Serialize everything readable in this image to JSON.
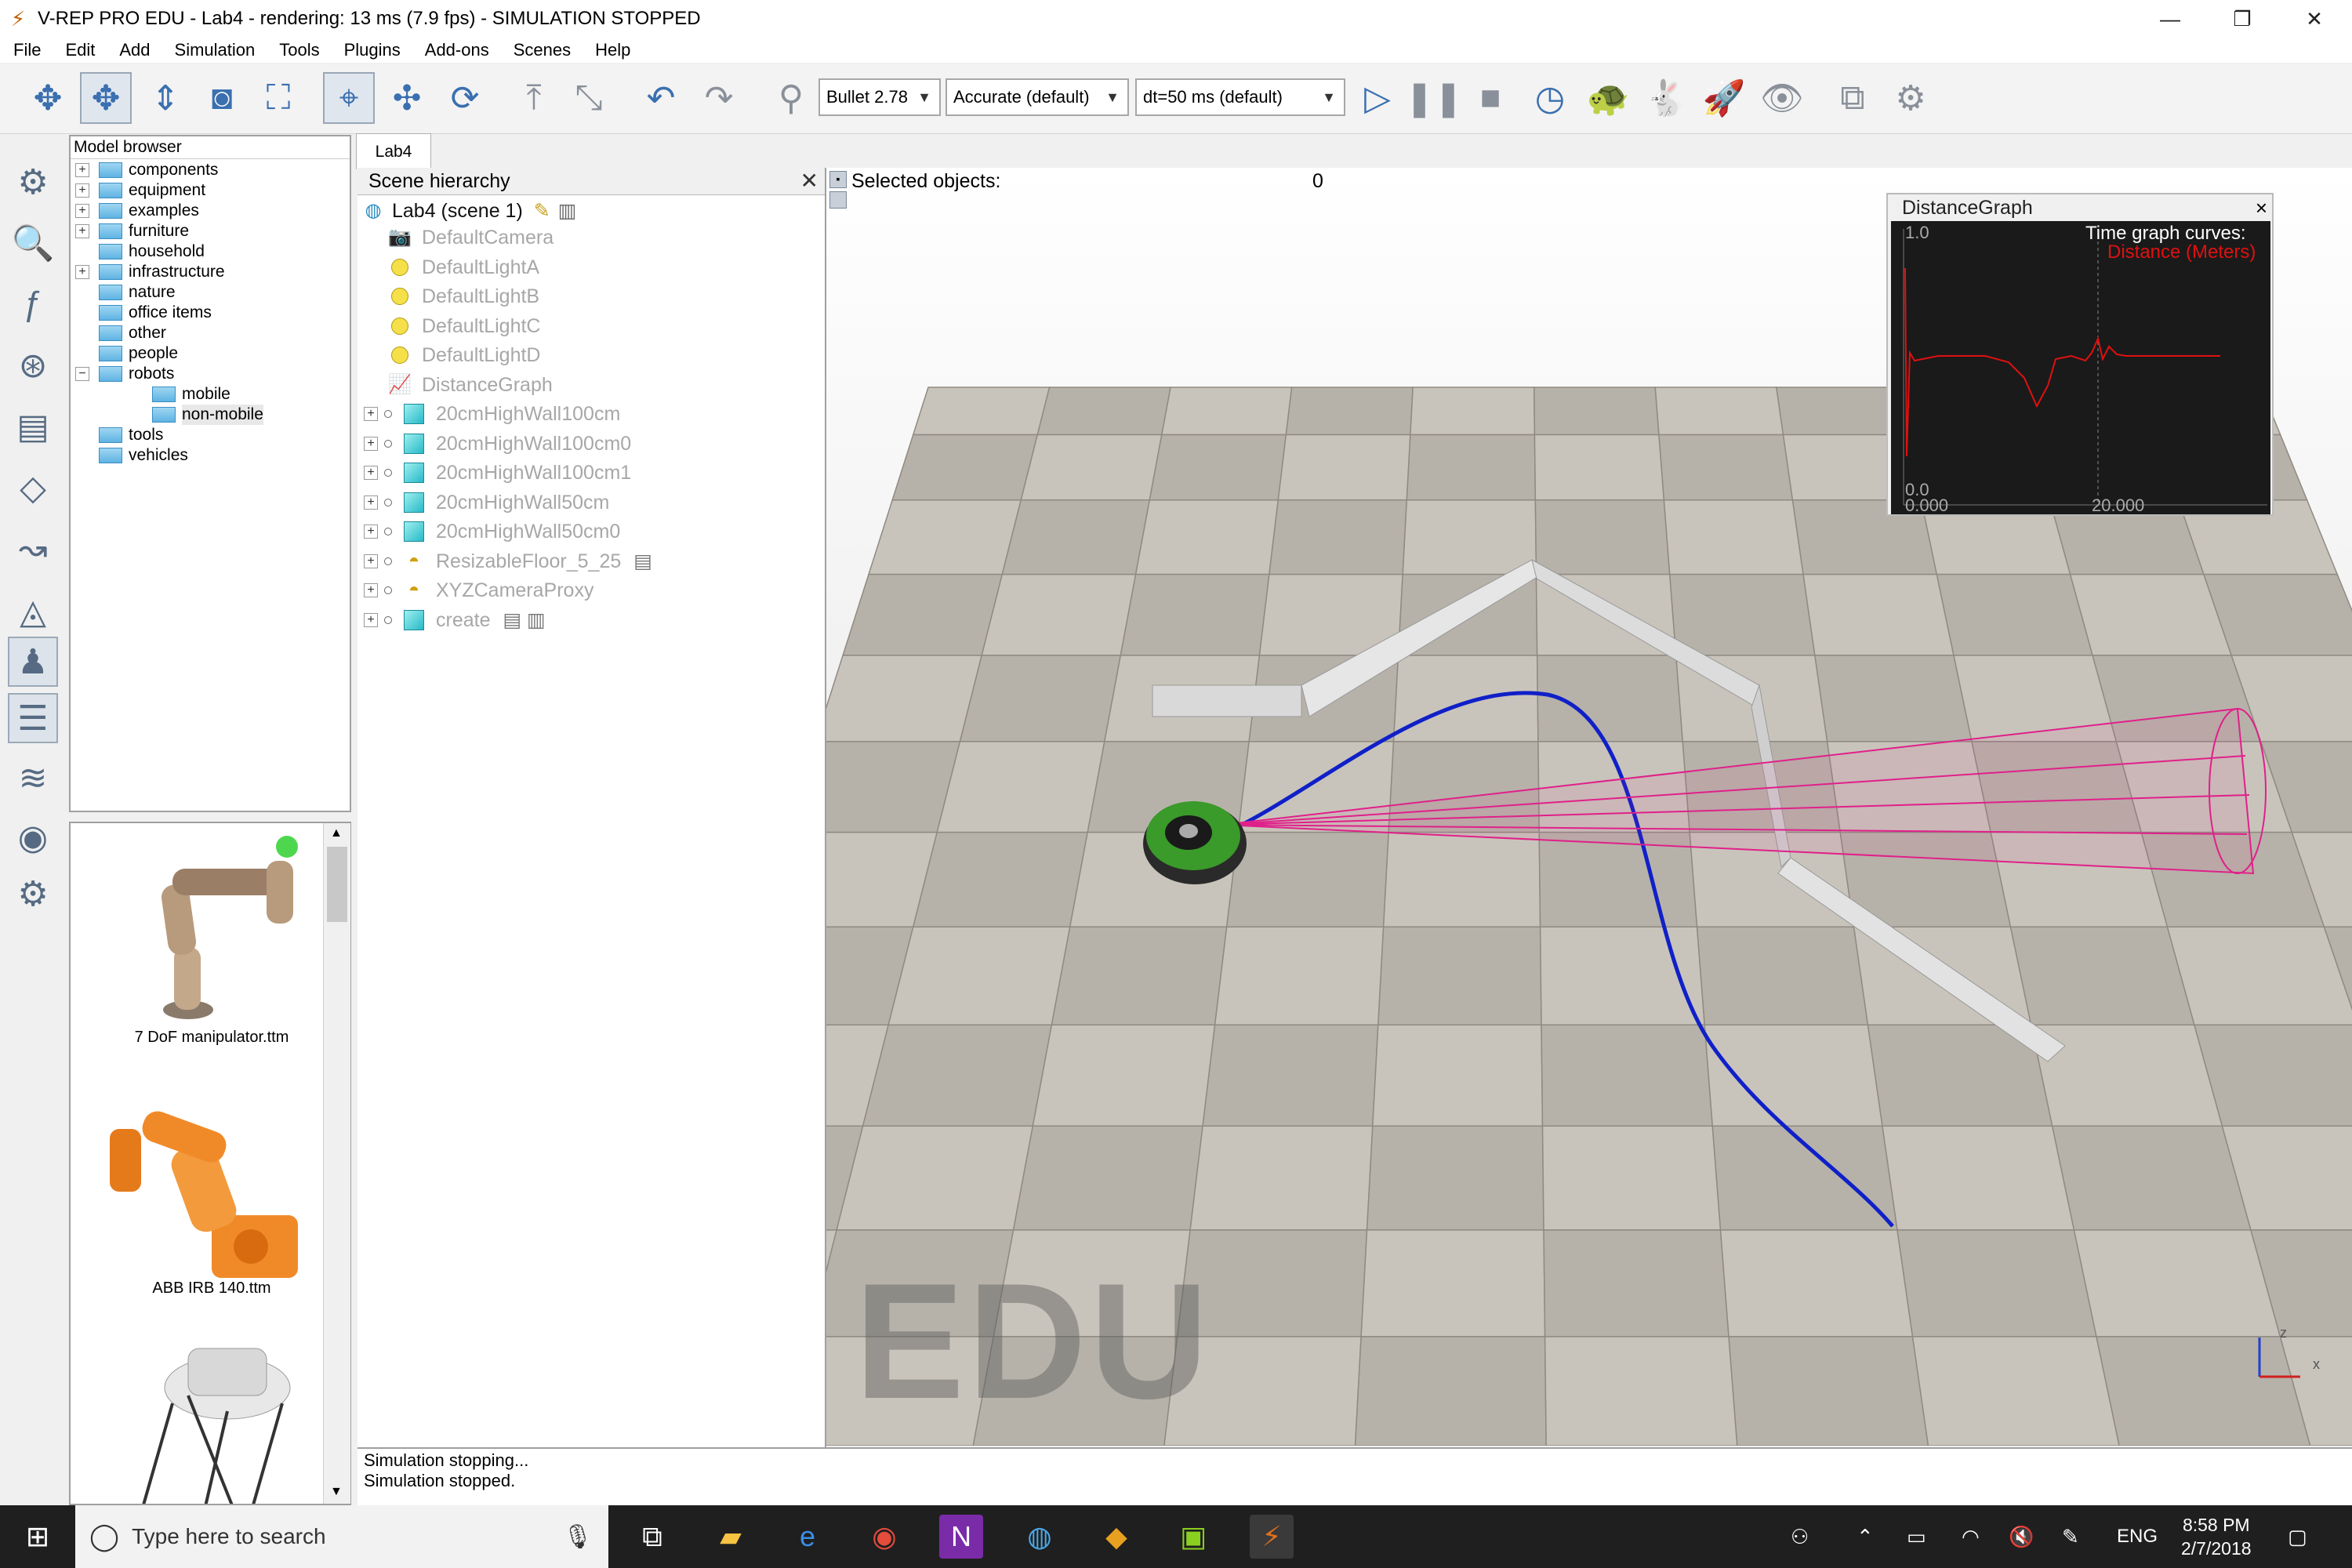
{
  "window": {
    "title": "V-REP PRO EDU - Lab4 - rendering: 13 ms (7.9 fps) - SIMULATION STOPPED",
    "minimize": "—",
    "restore": "❐",
    "close": "✕"
  },
  "menu": [
    "File",
    "Edit",
    "Add",
    "Simulation",
    "Tools",
    "Plugins",
    "Add-ons",
    "Scenes",
    "Help"
  ],
  "toolbar": {
    "physics_engine": "Bullet 2.78",
    "accuracy": "Accurate (default)",
    "timestep": "dt=50 ms (default)"
  },
  "model_browser": {
    "title": "Model browser",
    "items": [
      {
        "label": "components",
        "expander": "+"
      },
      {
        "label": "equipment",
        "expander": "+"
      },
      {
        "label": "examples",
        "expander": "+"
      },
      {
        "label": "furniture",
        "expander": "+"
      },
      {
        "label": "household",
        "expander": ""
      },
      {
        "label": "infrastructure",
        "expander": "+"
      },
      {
        "label": "nature",
        "expander": ""
      },
      {
        "label": "office items",
        "expander": ""
      },
      {
        "label": "other",
        "expander": ""
      },
      {
        "label": "people",
        "expander": ""
      },
      {
        "label": "robots",
        "expander": "−"
      },
      {
        "label": "mobile",
        "expander": ""
      },
      {
        "label": "non-mobile",
        "expander": ""
      },
      {
        "label": "tools",
        "expander": ""
      },
      {
        "label": "vehicles",
        "expander": ""
      }
    ],
    "thumbnails": [
      "7 DoF manipulator.ttm",
      "ABB IRB 140.ttm"
    ]
  },
  "document_tab": "Lab4",
  "scene_hierarchy": {
    "title": "Scene hierarchy",
    "close": "✕",
    "root": "Lab4 (scene 1)",
    "objects": [
      "DefaultCamera",
      "DefaultLightA",
      "DefaultLightB",
      "DefaultLightC",
      "DefaultLightD",
      "DistanceGraph",
      "20cmHighWall100cm",
      "20cmHighWall100cm0",
      "20cmHighWall100cm1",
      "20cmHighWall50cm",
      "20cmHighWall50cm0",
      "ResizableFloor_5_25",
      "XYZCameraProxy",
      "create"
    ]
  },
  "viewport": {
    "selected_label": "Selected objects:",
    "selected_count": "0",
    "watermark": "EDU",
    "axis_y": "z",
    "axis_x": "x"
  },
  "graph": {
    "title": "DistanceGraph",
    "close": "×",
    "legend_title": "Time graph curves:",
    "legend_series": "Distance (Meters)",
    "y_top": "1.0",
    "y_bottom": "0.0",
    "x_left": "0.000",
    "x_right": "20.000",
    "curve_color": "#e01010"
  },
  "status": {
    "line1": "Simulation stopping...",
    "line2": "Simulation stopped."
  },
  "taskbar": {
    "search_placeholder": "Type here to search",
    "language": "ENG",
    "time": "8:58 PM",
    "date": "2/7/2018"
  }
}
